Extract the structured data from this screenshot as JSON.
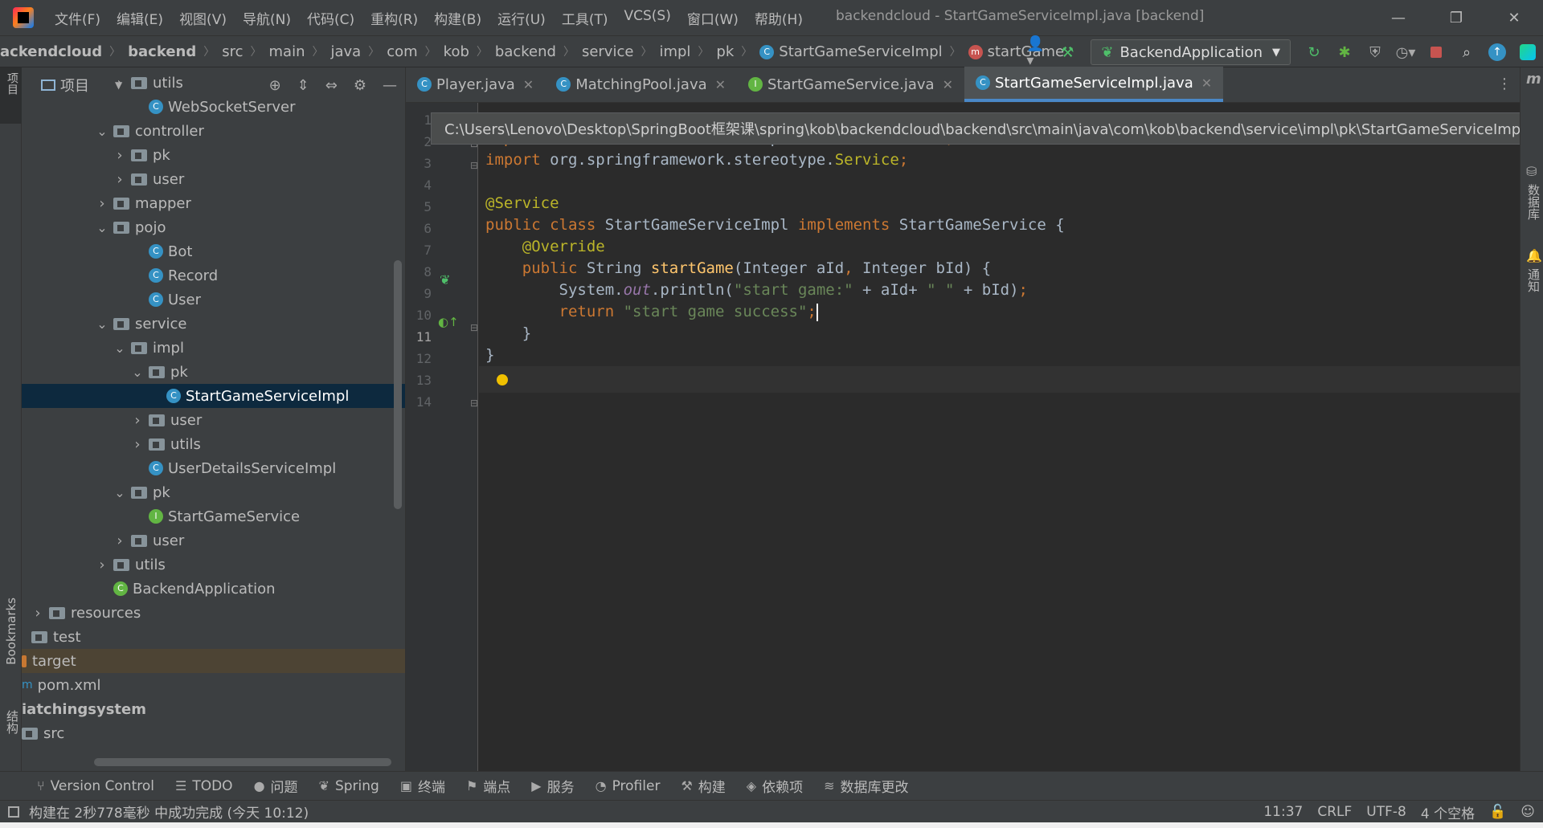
{
  "titlebar": {
    "menu": [
      "文件(F)",
      "编辑(E)",
      "视图(V)",
      "导航(N)",
      "代码(C)",
      "重构(R)",
      "构建(B)",
      "运行(U)",
      "工具(T)",
      "VCS(S)",
      "窗口(W)",
      "帮助(H)"
    ],
    "window_title": "backendcloud - StartGameServiceImpl.java [backend]",
    "minimize": "—",
    "restore": "❐",
    "close": "✕"
  },
  "breadcrumb": [
    "ackendcloud",
    "backend",
    "src",
    "main",
    "java",
    "com",
    "kob",
    "backend",
    "service",
    "impl",
    "pk",
    "StartGameServiceImpl",
    "startGame"
  ],
  "run_config": "BackendApplication",
  "project_panel": {
    "title": "项目",
    "tree": [
      {
        "label": "utils",
        "type": "folder",
        "arrow": "›",
        "indent": 2
      },
      {
        "label": "WebSocketServer",
        "type": "class",
        "indent": 3
      },
      {
        "label": "controller",
        "type": "folder",
        "arrow": "⌄",
        "indent": 1
      },
      {
        "label": "pk",
        "type": "folder",
        "arrow": "›",
        "indent": 2
      },
      {
        "label": "user",
        "type": "folder",
        "arrow": "›",
        "indent": 2
      },
      {
        "label": "mapper",
        "type": "folder",
        "arrow": "›",
        "indent": 1
      },
      {
        "label": "pojo",
        "type": "folder",
        "arrow": "⌄",
        "indent": 1
      },
      {
        "label": "Bot",
        "type": "class",
        "indent": 3
      },
      {
        "label": "Record",
        "type": "class",
        "indent": 3
      },
      {
        "label": "User",
        "type": "class",
        "indent": 3
      },
      {
        "label": "service",
        "type": "folder",
        "arrow": "⌄",
        "indent": 1
      },
      {
        "label": "impl",
        "type": "folder",
        "arrow": "⌄",
        "indent": 2
      },
      {
        "label": "pk",
        "type": "folder",
        "arrow": "⌄",
        "indent": 3
      },
      {
        "label": "StartGameServiceImpl",
        "type": "class",
        "indent": 4,
        "selected": true
      },
      {
        "label": "user",
        "type": "folder",
        "arrow": "›",
        "indent": 3
      },
      {
        "label": "utils",
        "type": "folder",
        "arrow": "›",
        "indent": 3
      },
      {
        "label": "UserDetailsServiceImpl",
        "type": "class",
        "indent": 3
      },
      {
        "label": "pk",
        "type": "folder",
        "arrow": "⌄",
        "indent": 2
      },
      {
        "label": "StartGameService",
        "type": "interface",
        "indent": 3
      },
      {
        "label": "user",
        "type": "folder",
        "arrow": "›",
        "indent": 2
      },
      {
        "label": "utils",
        "type": "folder",
        "arrow": "›",
        "indent": 1
      },
      {
        "label": "BackendApplication",
        "type": "app",
        "indent": 1
      },
      {
        "label": "resources",
        "type": "folder",
        "arrow": "›",
        "indent": -1
      },
      {
        "label": "test",
        "type": "folder",
        "indent": -1
      },
      {
        "label": "target",
        "type": "orange",
        "indent": -2,
        "excluded": true
      },
      {
        "label": "pom.xml",
        "type": "file",
        "indent": -2
      },
      {
        "label": "iatchingsystem",
        "type": "module",
        "indent": -2
      },
      {
        "label": "src",
        "type": "folder",
        "indent": -2
      }
    ]
  },
  "tabs": [
    {
      "label": "Player.java",
      "icon": "C",
      "active": false
    },
    {
      "label": "MatchingPool.java",
      "icon": "C",
      "active": false
    },
    {
      "label": "StartGameService.java",
      "icon": "I",
      "active": false
    },
    {
      "label": "StartGameServiceImpl.java",
      "icon": "C",
      "active": true
    }
  ],
  "tooltip": "C:\\Users\\Lenovo\\Desktop\\SpringBoot框架课\\spring\\kob\\backendcloud\\backend\\src\\main\\java\\com\\kob\\backend\\service\\impl\\pk\\StartGameServiceImpl.java",
  "editor": {
    "line_numbers": [
      "1",
      "2",
      "3",
      "4",
      "5",
      "6",
      "7",
      "8",
      "9",
      "10",
      "11",
      "12",
      "13",
      "14"
    ],
    "current_line": "11"
  },
  "right_stripe": {
    "database": "数据库",
    "notifications": "通知"
  },
  "left_stripe": {
    "project": "项目",
    "bookmarks": "Bookmarks",
    "structure": "结构"
  },
  "bottom_tools": [
    {
      "icon": "⑂",
      "label": "Version Control"
    },
    {
      "icon": "☰",
      "label": "TODO"
    },
    {
      "icon": "●",
      "label": "问题"
    },
    {
      "icon": "❦",
      "label": "Spring"
    },
    {
      "icon": "▣",
      "label": "终端"
    },
    {
      "icon": "⚑",
      "label": "端点"
    },
    {
      "icon": "▶",
      "label": "服务"
    },
    {
      "icon": "◔",
      "label": "Profiler"
    },
    {
      "icon": "⚒",
      "label": "构建"
    },
    {
      "icon": "◈",
      "label": "依赖项"
    },
    {
      "icon": "≋",
      "label": "数据库更改"
    }
  ],
  "status": {
    "message": "构建在 2秒778毫秒 中成功完成 (今天 10:12)",
    "position": "11:37",
    "line_sep": "CRLF",
    "encoding": "UTF-8",
    "indent": "4 个空格"
  }
}
